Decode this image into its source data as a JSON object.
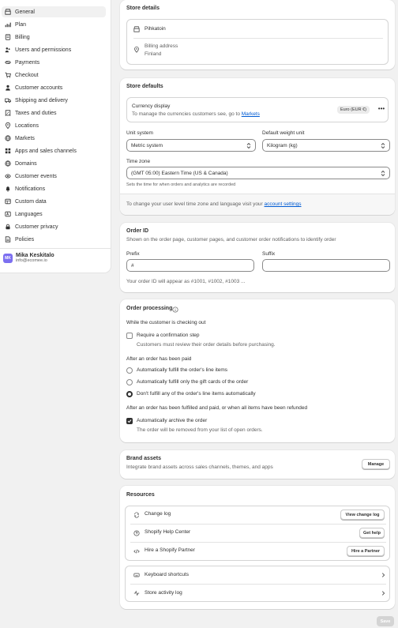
{
  "sidebar": {
    "items": [
      {
        "label": "General",
        "icon": "store-icon"
      },
      {
        "label": "Plan",
        "icon": "chart-icon"
      },
      {
        "label": "Billing",
        "icon": "billing-icon"
      },
      {
        "label": "Users and permissions",
        "icon": "users-icon"
      },
      {
        "label": "Payments",
        "icon": "payments-icon"
      },
      {
        "label": "Checkout",
        "icon": "cart-icon"
      },
      {
        "label": "Customer accounts",
        "icon": "person-icon"
      },
      {
        "label": "Shipping and delivery",
        "icon": "truck-icon"
      },
      {
        "label": "Taxes and duties",
        "icon": "taxes-icon"
      },
      {
        "label": "Locations",
        "icon": "location-icon"
      },
      {
        "label": "Markets",
        "icon": "globe-icon"
      },
      {
        "label": "Apps and sales channels",
        "icon": "apps-icon"
      },
      {
        "label": "Domains",
        "icon": "globe-icon"
      },
      {
        "label": "Customer events",
        "icon": "events-icon"
      },
      {
        "label": "Notifications",
        "icon": "bell-icon"
      },
      {
        "label": "Custom data",
        "icon": "data-icon"
      },
      {
        "label": "Languages",
        "icon": "language-icon"
      },
      {
        "label": "Customer privacy",
        "icon": "lock-icon"
      },
      {
        "label": "Policies",
        "icon": "policy-icon"
      }
    ],
    "user": {
      "initials": "MK",
      "name": "Mika Keskitalo",
      "email": "info@ecomee.io"
    }
  },
  "store_details": {
    "title": "Store details",
    "store_name": "Pihkatoin",
    "billing_label": "Billing address",
    "billing_country": "Finland"
  },
  "store_defaults": {
    "title": "Store defaults",
    "currency_label": "Currency display",
    "currency_desc": "To manage the currencies customers see, go to",
    "currency_link": "Markets",
    "currency_badge": "Euro (EUR €)",
    "unit_label": "Unit system",
    "unit_value": "Metric system",
    "weight_label": "Default weight unit",
    "weight_value": "Kilogram (kg)",
    "timezone_label": "Time zone",
    "timezone_value": "(GMT 05:00) Eastern Time (US & Canada)",
    "timezone_help": "Sets the time for when orders and analytics are recorded",
    "footer_text": "To change your user level time zone and language visit your",
    "footer_link": "account settings"
  },
  "order_id": {
    "title": "Order ID",
    "desc": "Shown on the order page, customer pages, and customer order notifications to identify order",
    "prefix_label": "Prefix",
    "prefix_value": "#",
    "suffix_label": "Suffix",
    "suffix_value": "",
    "preview": "Your order ID will appear as #1001, #1002, #1003 ..."
  },
  "order_processing": {
    "title": "Order processing",
    "checkout_heading": "While the customer is checking out",
    "require_label": "Require a confirmation step",
    "require_desc": "Customers must review their order details before purchasing.",
    "paid_heading": "After an order has been paid",
    "radio_1": "Automatically fulfill the order's line items",
    "radio_2": "Automatically fulfill only the gift cards of the order",
    "radio_3": "Don't fulfill any of the order's line items automatically",
    "fulfilled_heading": "After an order has been fulfilled and paid, or when all items have been refunded",
    "archive_label": "Automatically archive the order",
    "archive_desc": "The order will be removed from your list of open orders."
  },
  "brand_assets": {
    "title": "Brand assets",
    "desc": "Integrate brand assets across sales channels, themes, and apps",
    "button": "Manage"
  },
  "resources": {
    "title": "Resources",
    "rows": [
      {
        "label": "Change log",
        "button": "View change log",
        "icon": "changelog-icon"
      },
      {
        "label": "Shopify Help Center",
        "button": "Get help",
        "icon": "help-icon"
      },
      {
        "label": "Hire a Shopify Partner",
        "button": "Hire a Partner",
        "icon": "code-icon"
      }
    ],
    "links": [
      {
        "label": "Keyboard shortcuts",
        "icon": "keyboard-icon"
      },
      {
        "label": "Store activity log",
        "icon": "activity-icon"
      }
    ]
  },
  "footer": {
    "save_label": "Save"
  },
  "colors": {
    "accent": "#7c6ff0",
    "link": "#005bd3",
    "background": "#f1f1f1"
  }
}
